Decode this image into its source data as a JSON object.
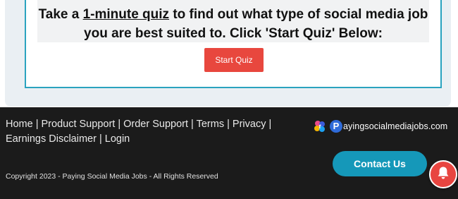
{
  "quiz": {
    "text_before": "Take a ",
    "link_text": "1-minute quiz",
    "text_after": " to find out what type of social media job you are best suited to. Click 'Start Quiz' Below:",
    "button_label": "Start Quiz"
  },
  "footer": {
    "links": [
      "Home",
      "Product Support",
      "Order Support",
      "Terms",
      "Privacy",
      "Earnings Disclaimer",
      "Login"
    ],
    "separator": " | ",
    "brand_text": "ayingsocialmediajobs.com",
    "brand_initial": "P",
    "contact_label": "Contact Us",
    "copyright": "Copyright 2023 - Paying Social Media Jobs - All Rights Reserved"
  },
  "colors": {
    "accent": "#2aa3bf",
    "start_button": "#e8473e",
    "contact_button": "#1598b9",
    "footer_bg": "#1b1b1b",
    "notification": "#e84540"
  },
  "icons": {
    "brand_logo": "social-media-logo-icon",
    "notification": "bell-icon"
  }
}
